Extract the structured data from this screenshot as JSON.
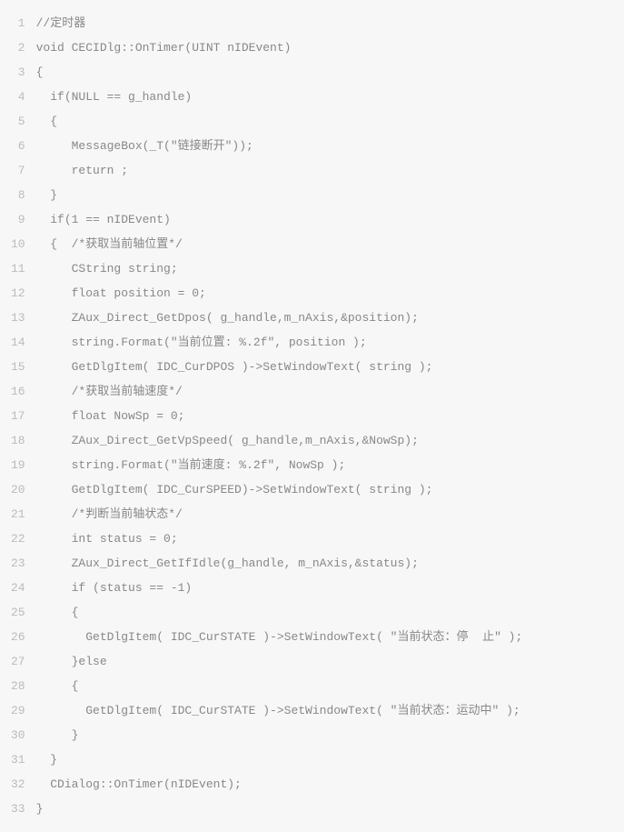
{
  "code": {
    "lines": [
      "//定时器",
      "void CECIDlg::OnTimer(UINT nIDEvent)",
      "{",
      "  if(NULL == g_handle)",
      "  {",
      "     MessageBox(_T(\"链接断开\"));",
      "     return ;",
      "  }",
      "  if(1 == nIDEvent)",
      "  {  /*获取当前轴位置*/",
      "     CString string;",
      "     float position = 0;",
      "     ZAux_Direct_GetDpos( g_handle,m_nAxis,&position);",
      "     string.Format(\"当前位置: %.2f\", position );",
      "     GetDlgItem( IDC_CurDPOS )->SetWindowText( string );",
      "     /*获取当前轴速度*/",
      "     float NowSp = 0;",
      "     ZAux_Direct_GetVpSpeed( g_handle,m_nAxis,&NowSp);",
      "     string.Format(\"当前速度: %.2f\", NowSp );",
      "     GetDlgItem( IDC_CurSPEED)->SetWindowText( string );",
      "     /*判断当前轴状态*/",
      "     int status = 0;",
      "     ZAux_Direct_GetIfIdle(g_handle, m_nAxis,&status);",
      "     if (status == -1)",
      "     {",
      "       GetDlgItem( IDC_CurSTATE )->SetWindowText( \"当前状态：停  止\" );",
      "     }else",
      "     {",
      "       GetDlgItem( IDC_CurSTATE )->SetWindowText( \"当前状态：运动中\" );",
      "     }",
      "  }",
      "  CDialog::OnTimer(nIDEvent);",
      "}"
    ]
  }
}
